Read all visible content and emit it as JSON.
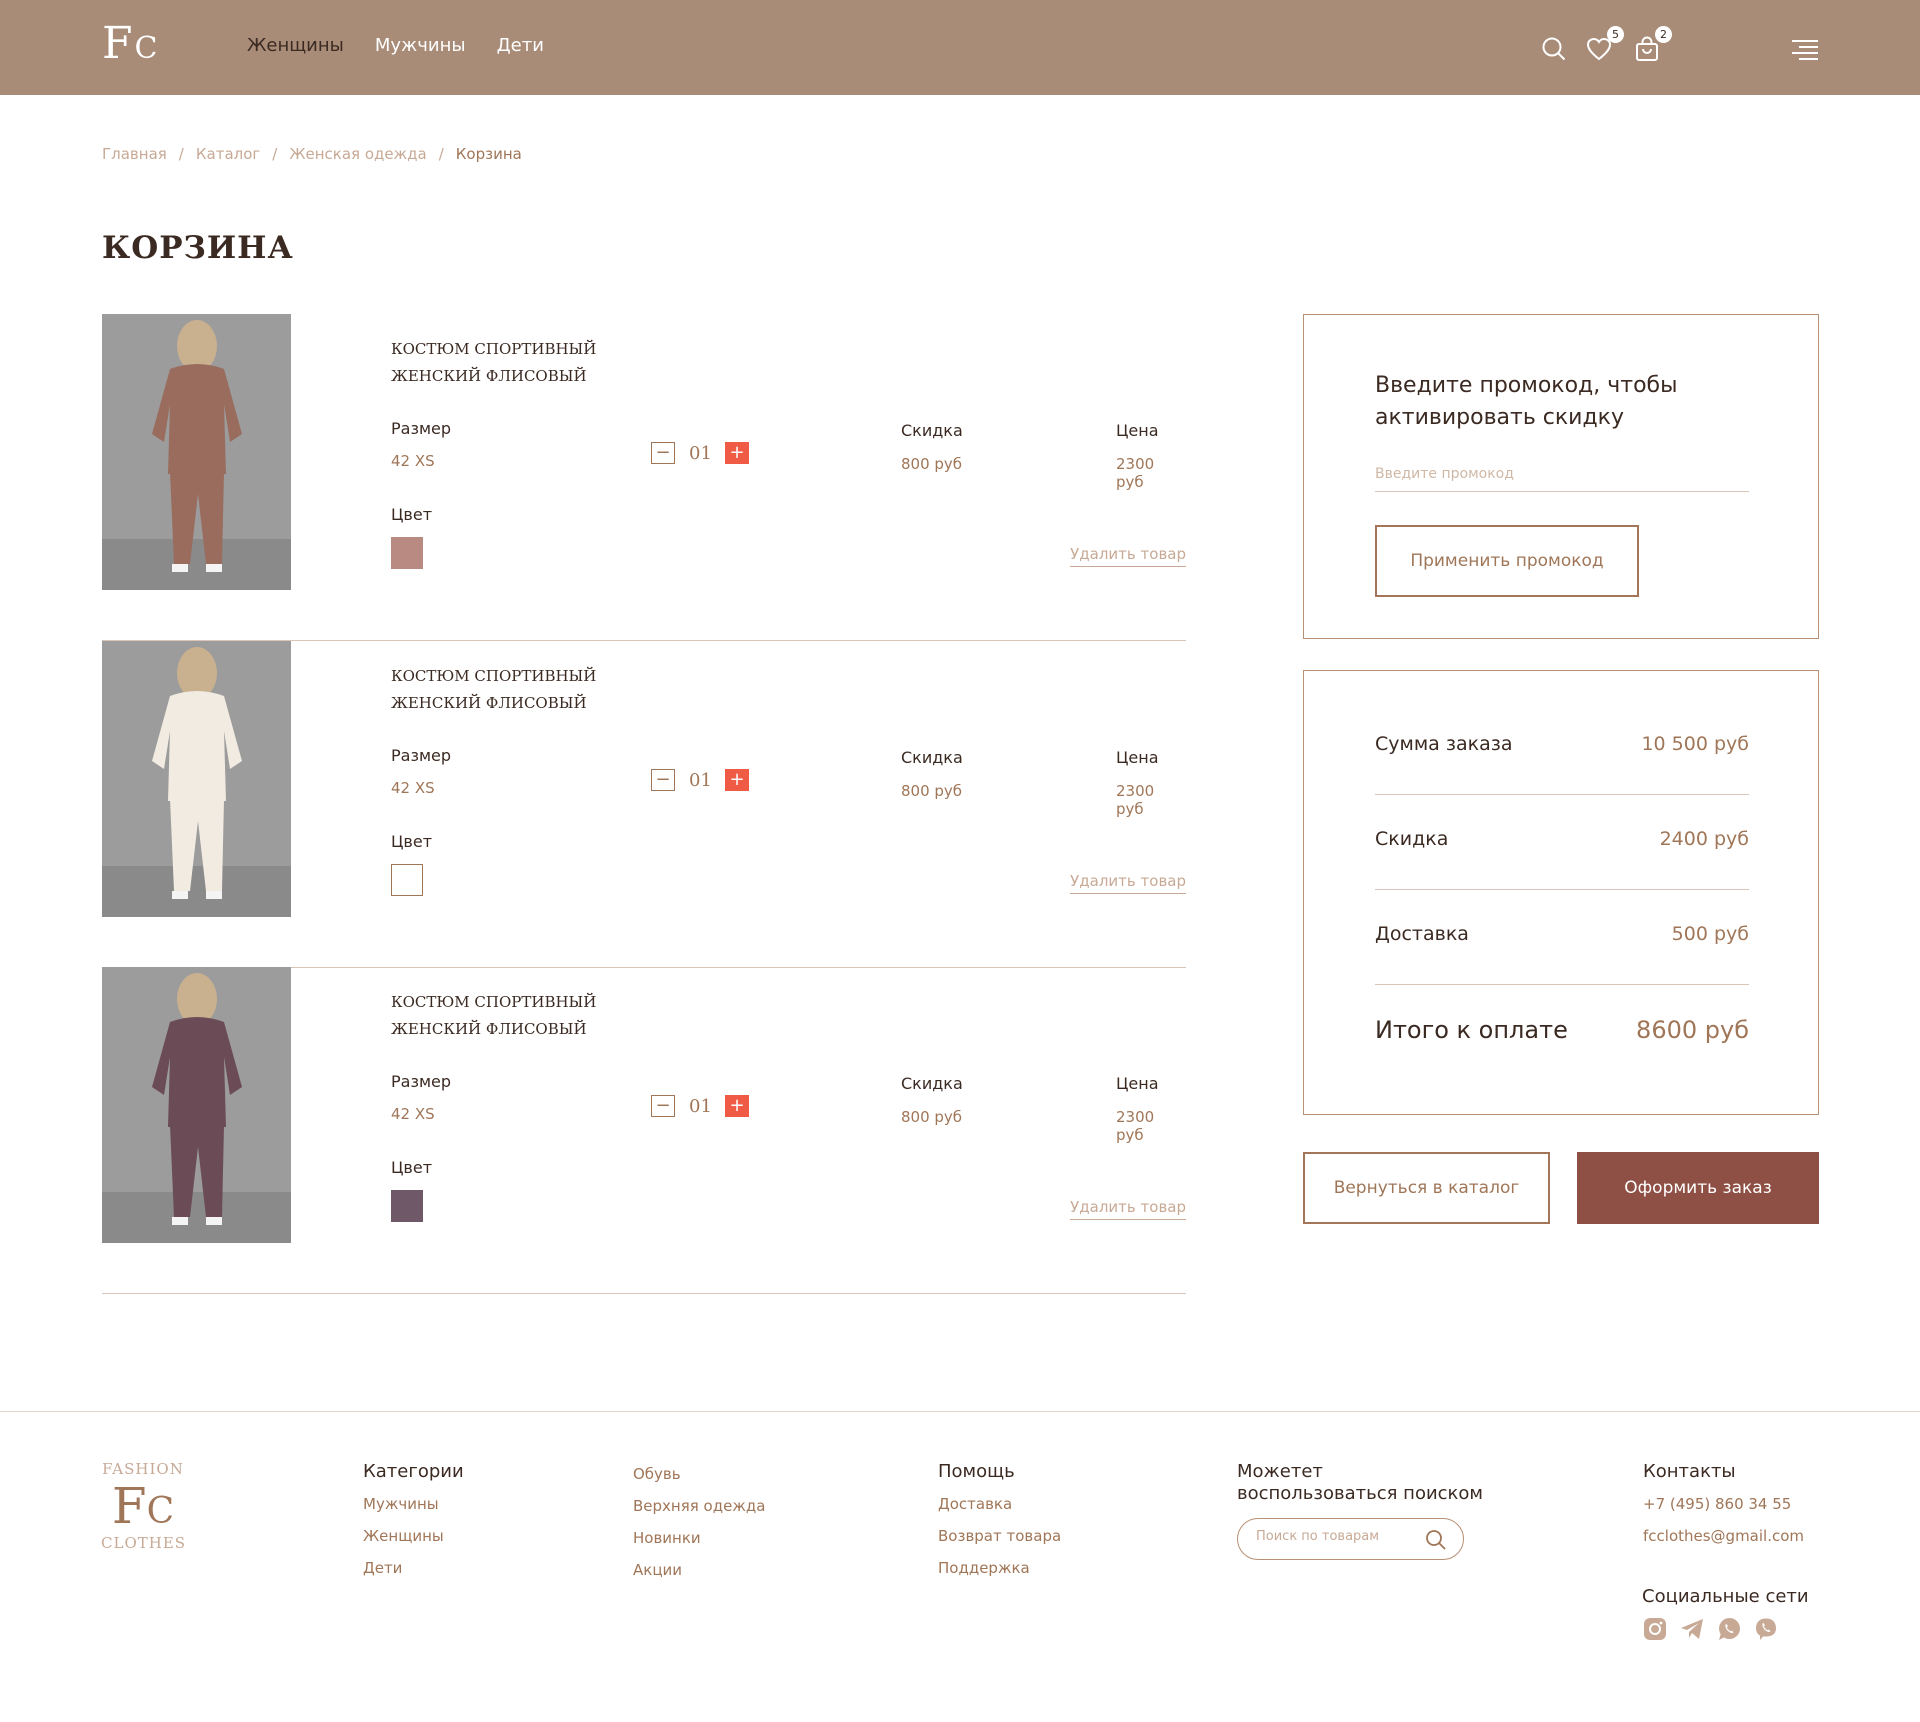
{
  "header": {
    "logo_big": "F",
    "logo_small": "C",
    "nav": [
      "Женщины",
      "Мужчины",
      "Дети"
    ],
    "wishlist_count": "5",
    "cart_count": "2"
  },
  "breadcrumb": [
    "Главная",
    "Каталог",
    "Женская одежда",
    "Корзина"
  ],
  "page_title": "КОРЗИНА",
  "labels": {
    "size": "Размер",
    "color": "Цвет",
    "discount": "Скидка",
    "price": "Цена",
    "remove": "Удалить товар",
    "minus": "−",
    "plus": "+"
  },
  "items": [
    {
      "name": "КОСТЮМ СПОРТИВНЫЙ ЖЕНСКИЙ ФЛИСОВЫЙ",
      "size": "42 XS",
      "qty": "01",
      "discount": "800 руб",
      "price": "2300 руб",
      "color_hex": "#b98a82",
      "garment_hex": "#9a6c5e"
    },
    {
      "name": "КОСТЮМ СПОРТИВНЫЙ ЖЕНСКИЙ ФЛИСОВЫЙ",
      "size": "42 XS",
      "qty": "01",
      "discount": "800 руб",
      "price": "2300 руб",
      "color_hex": "#ffffff",
      "garment_hex": "#f1ebe2"
    },
    {
      "name": "КОСТЮМ СПОРТИВНЫЙ ЖЕНСКИЙ ФЛИСОВЫЙ",
      "size": "42 XS",
      "qty": "01",
      "discount": "800 руб",
      "price": "2300 руб",
      "color_hex": "#6f5868",
      "garment_hex": "#6b4c56"
    }
  ],
  "promo": {
    "title": "Введите промокод, чтобы активировать скидку",
    "placeholder": "Введите промокод",
    "button": "Применить промокод"
  },
  "summary": {
    "order_sum_label": "Сумма заказа",
    "order_sum": "10 500 руб",
    "discount_label": "Скидка",
    "discount": "2400 руб",
    "delivery_label": "Доставка",
    "delivery": "500 руб",
    "total_label": "Итого к оплате",
    "total": "8600 руб"
  },
  "actions": {
    "back": "Вернуться в каталог",
    "order": "Оформить заказ"
  },
  "footer": {
    "logo_top": "FASHION",
    "logo_big": "F",
    "logo_small": "C",
    "logo_bottom": "CLOTHES",
    "categories_title": "Категории",
    "categories": [
      "Мужчины",
      "Женщины",
      "Дети"
    ],
    "more": [
      "Обувь",
      "Верхняя одежда",
      "Новинки",
      "Акции"
    ],
    "help_title": "Помощь",
    "help": [
      "Доставка",
      "Возврат товара",
      "Поддержка"
    ],
    "search_title": "Можетет воспользоваться поиском",
    "search_placeholder": "Поиск по товарам",
    "contacts_title": "Контакты",
    "phone": "+7 (495) 860 34 55",
    "email": "fcclothes@gmail.com",
    "social_title": "Социальные сети"
  },
  "colors": {
    "header_bg": "#a88c78",
    "accent": "#a07658",
    "plus_btn": "#ef5b45",
    "order_btn": "#8e4f44"
  },
  "icons": [
    "search-icon",
    "heart-icon",
    "bag-icon",
    "menu-icon",
    "instagram-icon",
    "telegram-icon",
    "whatsapp-icon",
    "viber-icon"
  ]
}
